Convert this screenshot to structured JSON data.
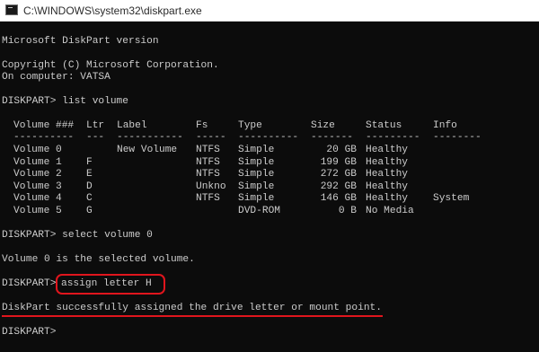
{
  "window": {
    "title": "C:\\WINDOWS\\system32\\diskpart.exe"
  },
  "console": {
    "version_line": "Microsoft DiskPart version",
    "copyright_line": "Copyright (C) Microsoft Corporation.",
    "computer_line": "On computer: VATSA",
    "prompt_list_volume": "DISKPART> list volume",
    "table": {
      "headers": [
        "Volume ###",
        "Ltr",
        "Label",
        "Fs",
        "Type",
        "Size",
        "Status",
        "Info"
      ],
      "separators": [
        "----------",
        "---",
        "-----------",
        "-----",
        "----------",
        "-------",
        "---------",
        "--------"
      ],
      "rows": [
        [
          "Volume 0",
          "",
          "New Volume",
          "NTFS",
          "Simple",
          "20 GB",
          "Healthy",
          ""
        ],
        [
          "Volume 1",
          "F",
          "",
          "NTFS",
          "Simple",
          "199 GB",
          "Healthy",
          ""
        ],
        [
          "Volume 2",
          "E",
          "",
          "NTFS",
          "Simple",
          "272 GB",
          "Healthy",
          ""
        ],
        [
          "Volume 3",
          "D",
          "",
          "Unkno",
          "Simple",
          "292 GB",
          "Healthy",
          ""
        ],
        [
          "Volume 4",
          "C",
          "",
          "NTFS",
          "Simple",
          "146 GB",
          "Healthy",
          "System"
        ],
        [
          "Volume 5",
          "G",
          "",
          "",
          "DVD-ROM",
          "0 B",
          "No Media",
          ""
        ]
      ]
    },
    "prompt_select_volume": "DISKPART> select volume 0",
    "selected_msg": "Volume 0 is the selected volume.",
    "prompt_label": "DISKPART>",
    "assign_cmd": "assign letter H",
    "success_msg": "DiskPart successfully assigned the drive letter or mount point.",
    "final_prompt": "DISKPART>"
  },
  "colors": {
    "console_bg": "#0c0c0c",
    "console_text": "#cccccc",
    "annotation": "#e0151d"
  }
}
